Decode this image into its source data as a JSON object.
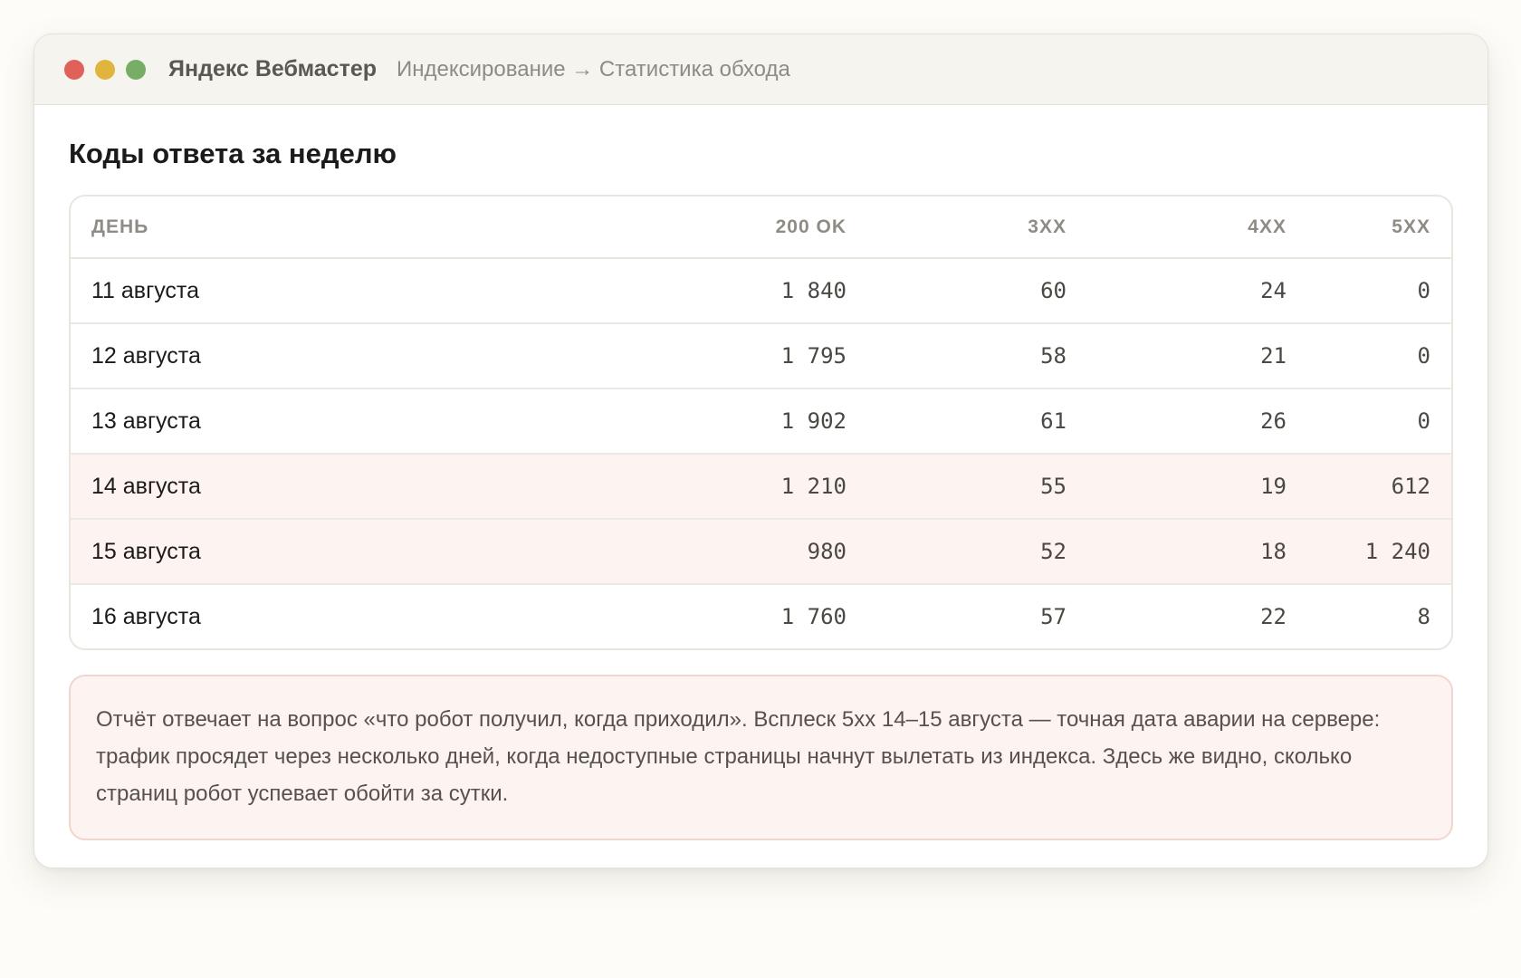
{
  "window": {
    "app_title": "Яндекс Вебмастер",
    "breadcrumb": "Индексирование → Статистика обхода",
    "controls": {
      "close_color": "#e0605a",
      "minimize_color": "#e1b43d",
      "maximize_color": "#78ad66"
    }
  },
  "page": {
    "title": "Коды ответа за неделю"
  },
  "table": {
    "columns": [
      "День",
      "200 OK",
      "3xx",
      "4xx",
      "5xx"
    ],
    "rows": [
      {
        "day": "11 августа",
        "ok": "1 840",
        "r3xx": "60",
        "r4xx": "24",
        "r5xx": "0",
        "highlight": false
      },
      {
        "day": "12 августа",
        "ok": "1 795",
        "r3xx": "58",
        "r4xx": "21",
        "r5xx": "0",
        "highlight": false
      },
      {
        "day": "13 августа",
        "ok": "1 902",
        "r3xx": "61",
        "r4xx": "26",
        "r5xx": "0",
        "highlight": false
      },
      {
        "day": "14 августа",
        "ok": "1 210",
        "r3xx": "55",
        "r4xx": "19",
        "r5xx": "612",
        "highlight": true
      },
      {
        "day": "15 августа",
        "ok": "980",
        "r3xx": "52",
        "r4xx": "18",
        "r5xx": "1 240",
        "highlight": true
      },
      {
        "day": "16 августа",
        "ok": "1 760",
        "r3xx": "57",
        "r4xx": "22",
        "r5xx": "8",
        "highlight": false
      }
    ],
    "highlight_color": "#fdf3f0"
  },
  "note": {
    "text": "Отчёт отвечает на вопрос «что робот получил, когда приходил». Всплеск 5xx 14–15 августа — точная дата аварии на сервере: трафик просядет через несколько дней, когда недоступные страницы начнут вылетать из индекса. Здесь же видно, сколько страниц робот успевает обойти за сутки."
  }
}
